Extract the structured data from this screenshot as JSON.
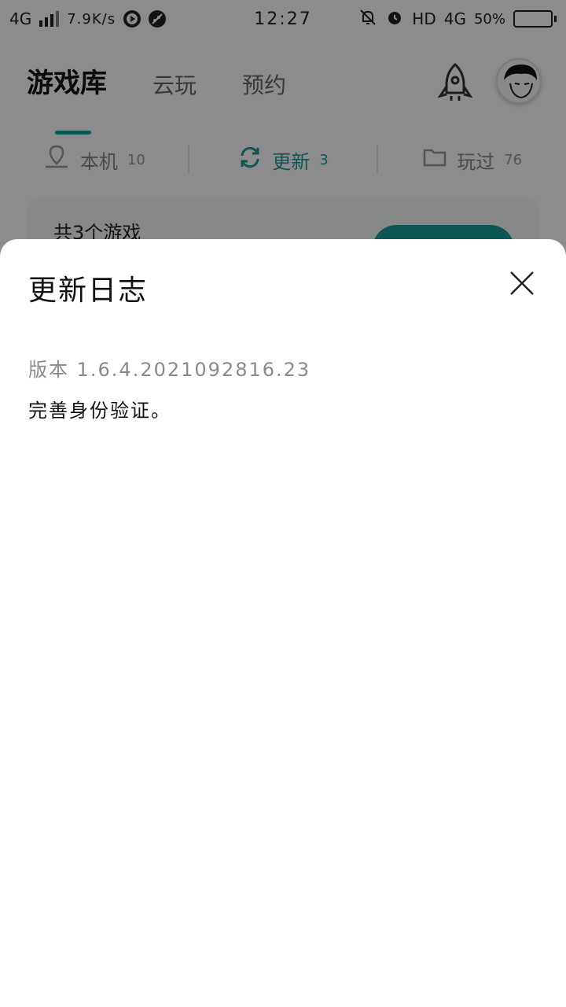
{
  "status_bar": {
    "network": "4G",
    "speed": "7.9K/s",
    "time": "12:27",
    "hd": "HD",
    "network2": "4G",
    "battery": "50%",
    "battery_level": 0.5
  },
  "app": {
    "top_tabs": [
      {
        "label": "游戏库",
        "active": true
      },
      {
        "label": "云玩",
        "active": false
      },
      {
        "label": "预约",
        "active": false
      }
    ],
    "sub_tabs": [
      {
        "label": "本机",
        "count": "10",
        "icon": "location-icon",
        "active": false
      },
      {
        "label": "更新",
        "count": "3",
        "icon": "refresh-icon",
        "active": true
      },
      {
        "label": "玩过",
        "count": "76",
        "icon": "folder-icon",
        "active": false
      }
    ],
    "summary": {
      "text": "共3个游戏",
      "button_label": ""
    }
  },
  "sheet": {
    "title": "更新日志",
    "version": "版本 1.6.4.2021092816.23",
    "changelog": "完善身份验证。"
  },
  "colors": {
    "accent": "#1a9e9e",
    "overlay": "rgba(0,0,0,0.45)"
  }
}
